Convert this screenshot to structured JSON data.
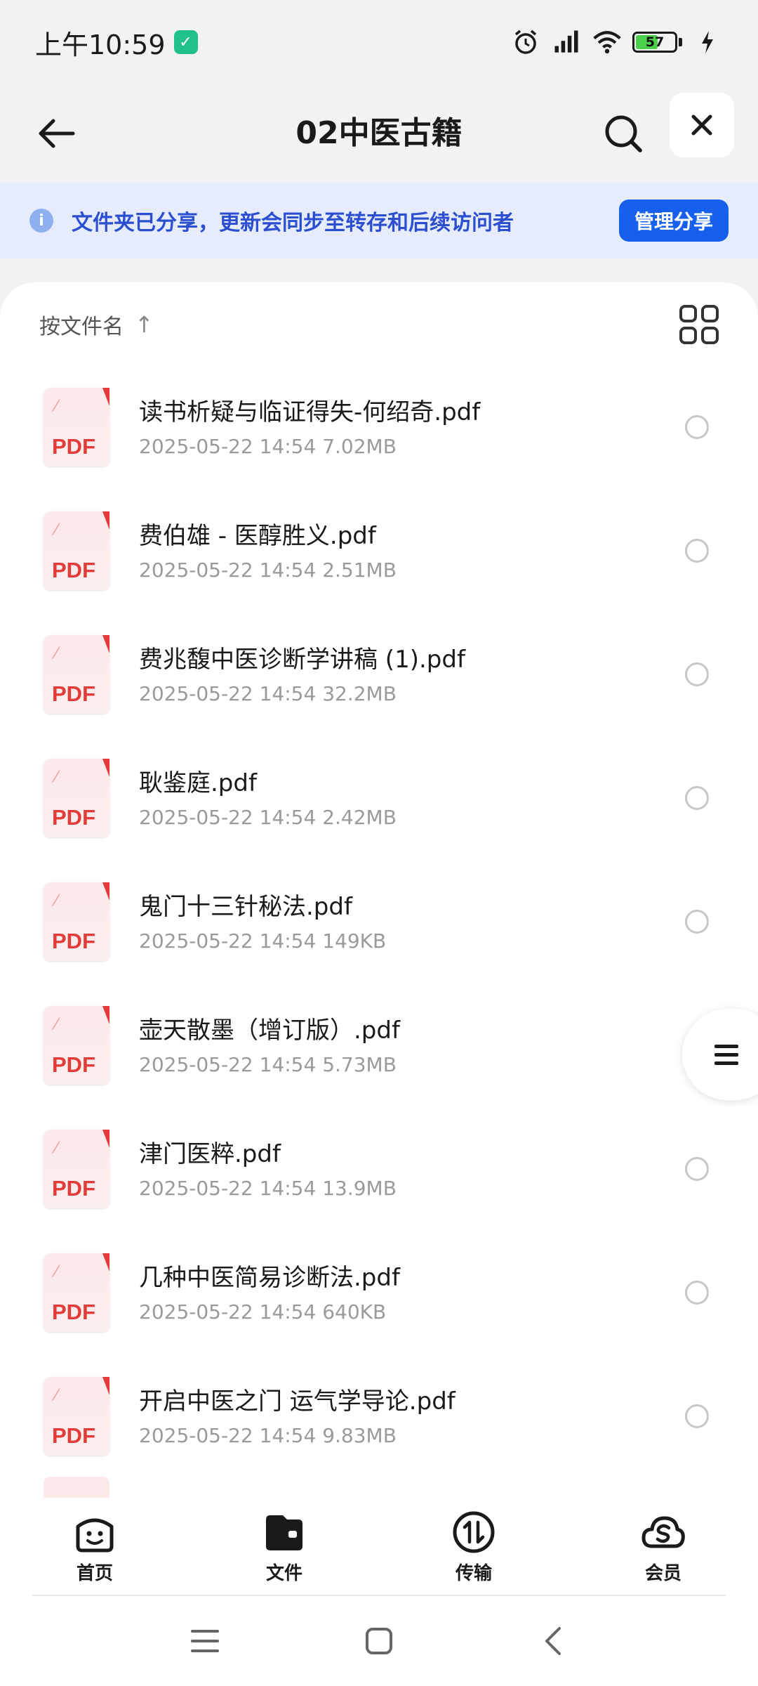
{
  "status_bar": {
    "time": "上午10:59",
    "battery": "57"
  },
  "header": {
    "title": "02中医古籍"
  },
  "share_banner": {
    "text": "文件夹已分享，更新会同步至转存和后续访问者",
    "button": "管理分享"
  },
  "sort": {
    "label": "按文件名",
    "arrow": "↑"
  },
  "files": [
    {
      "name": "读书析疑与临证得失-何绍奇.pdf",
      "meta": "2025-05-22 14:54  7.02MB",
      "type": "PDF"
    },
    {
      "name": "费伯雄 - 医醇胜义.pdf",
      "meta": "2025-05-22 14:54  2.51MB",
      "type": "PDF"
    },
    {
      "name": "费兆馥中医诊断学讲稿 (1).pdf",
      "meta": "2025-05-22 14:54  32.2MB",
      "type": "PDF"
    },
    {
      "name": "耿鉴庭.pdf",
      "meta": "2025-05-22 14:54  2.42MB",
      "type": "PDF"
    },
    {
      "name": "鬼门十三针秘法.pdf",
      "meta": "2025-05-22 14:54  149KB",
      "type": "PDF"
    },
    {
      "name": "壶天散墨（增订版）.pdf",
      "meta": "2025-05-22 14:54  5.73MB",
      "type": "PDF"
    },
    {
      "name": "津门医粹.pdf",
      "meta": "2025-05-22 14:54  13.9MB",
      "type": "PDF"
    },
    {
      "name": "几种中医简易诊断法.pdf",
      "meta": "2025-05-22 14:54  640KB",
      "type": "PDF"
    },
    {
      "name": "开启中医之门 运气学导论.pdf",
      "meta": "2025-05-22 14:54  9.83MB",
      "type": "PDF"
    }
  ],
  "bottom_nav": {
    "home": "首页",
    "files": "文件",
    "transfer": "传输",
    "member": "会员"
  },
  "colors": {
    "accent": "#1760ee",
    "banner_bg": "#e6ecfb",
    "pdf_red": "#e33a3a"
  }
}
